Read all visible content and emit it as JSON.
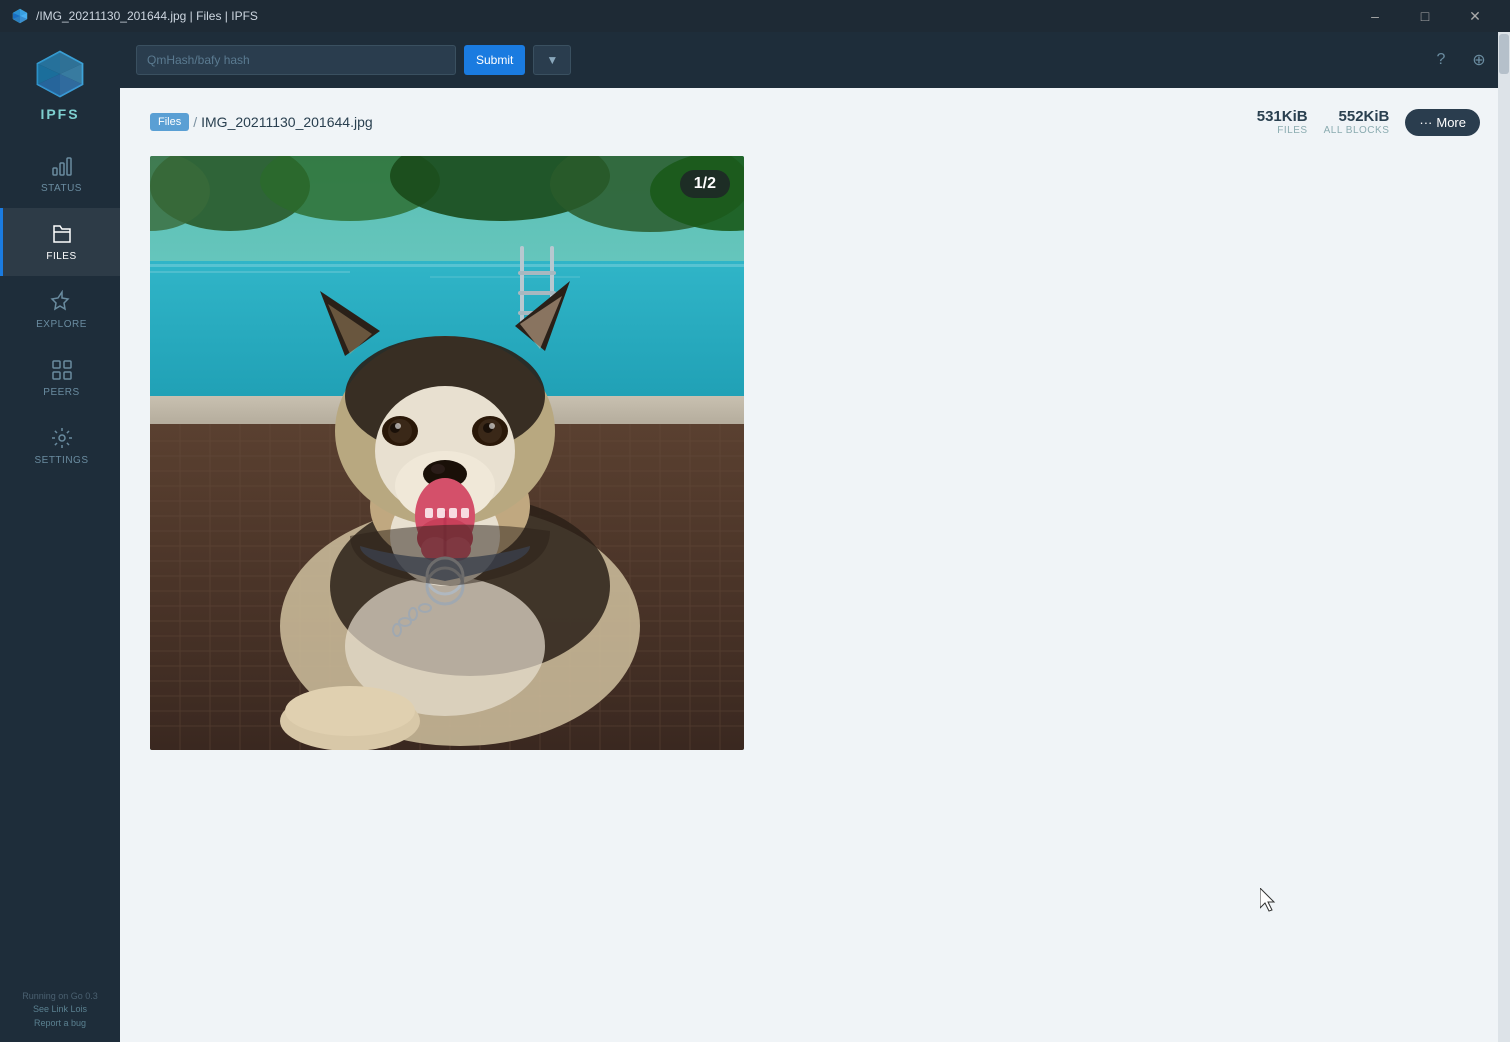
{
  "titleBar": {
    "title": "/IMG_20211130_201644.jpg | Files | IPFS",
    "iconAlt": "IPFS",
    "minimizeLabel": "minimize",
    "maximizeLabel": "maximize",
    "closeLabel": "close"
  },
  "sidebar": {
    "logoText": "IPFS",
    "items": [
      {
        "id": "status",
        "label": "STATUS",
        "active": false
      },
      {
        "id": "files",
        "label": "FILES",
        "active": true
      },
      {
        "id": "explore",
        "label": "EXPLORE",
        "active": false
      },
      {
        "id": "peers",
        "label": "PEERS",
        "active": false
      },
      {
        "id": "settings",
        "label": "SETTINGS",
        "active": false
      }
    ],
    "footer": {
      "line1": "Running on Go 0.3",
      "line2": "See Link Lois",
      "line3": "Report a bug"
    }
  },
  "topBar": {
    "searchPlaceholder": "QmHash/bafy hash",
    "searchValue": "QmHash/bafyHash",
    "submitLabel": "Submit",
    "helpLabel": "?",
    "accountLabel": "⊕"
  },
  "breadcrumb": {
    "folderLabel": "Files",
    "separator": "/",
    "fileName": "IMG_20211130_201644.jpg"
  },
  "fileStats": {
    "filesSize": "531KiB",
    "filesLabel": "FILES",
    "allBlocksSize": "552KiB",
    "allBlocksLabel": "ALL BLOCKS",
    "moreLabel": "More",
    "moreDots": "···"
  },
  "imageViewer": {
    "badge": "1/2",
    "altText": "Dog photo - Husky mix sitting by a pool"
  },
  "colors": {
    "accent": "#1a7be0",
    "sidebar": "#1e2d3a",
    "titleBar": "#1e2a35",
    "activeIndicator": "#1a7be0",
    "moreBtn": "#2a3d4e"
  }
}
